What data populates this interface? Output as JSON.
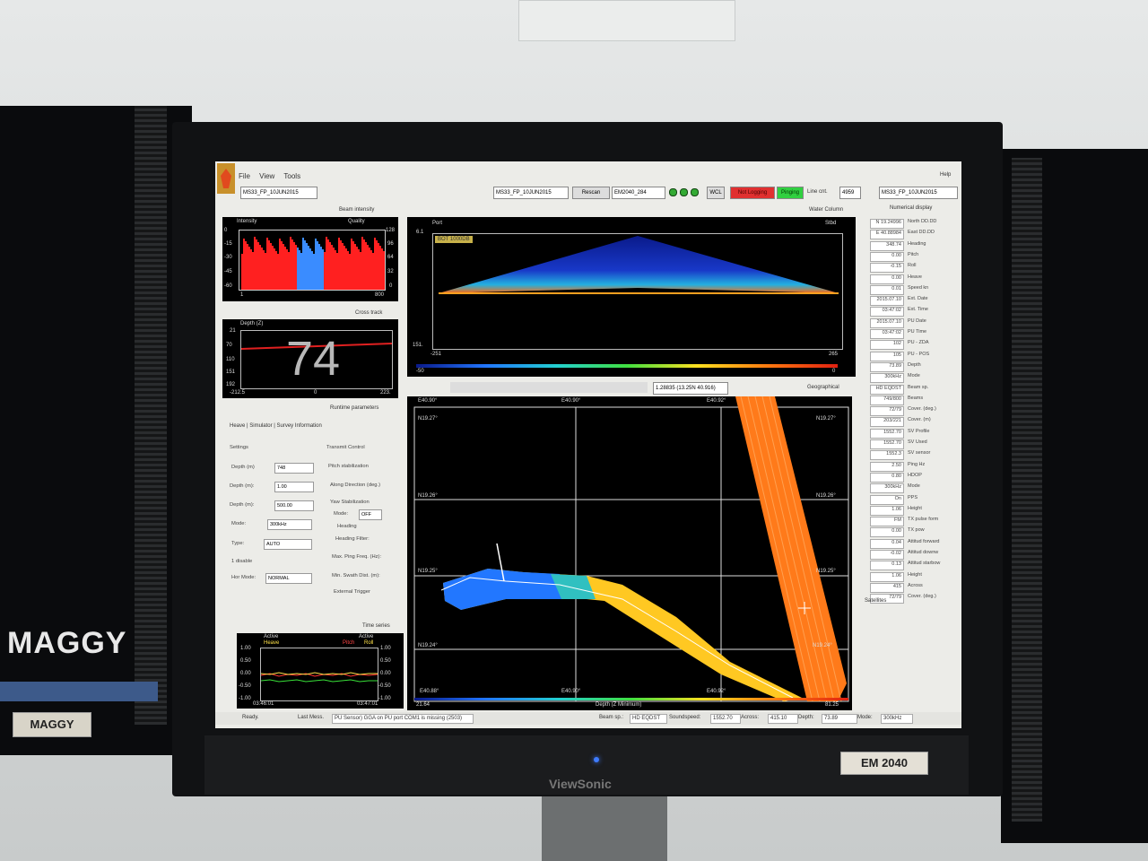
{
  "room": {
    "left_monitor_name": "MAGGY",
    "left_monitor_tag": "MAGGY",
    "right_tag": "EM 2040",
    "brand": "ViewSonic"
  },
  "app": {
    "menu": [
      "File",
      "View",
      "Tools"
    ],
    "help": "Help",
    "survey_select": "MS33_FP_10JUN2015",
    "survey_select2": "MS33_FP_10JUN2015",
    "rescan": "Rescan",
    "sonar_select": "EM2040_284",
    "wcl": "WCL",
    "not_logging": "Not Logging",
    "pinging": "Pinging",
    "line_cnt_label": "Line cnt.",
    "line_cnt": "4959",
    "survey_select3": "MS33_FP_10JUN2015"
  },
  "beam_panel": {
    "mode": "Beam intensity",
    "intensity_label": "Intensity",
    "quality_label": "Quality",
    "y_ticks": [
      "0",
      "-15",
      "-30",
      "-45",
      "-60"
    ],
    "q_ticks": [
      "128",
      "96",
      "64",
      "32",
      "0"
    ],
    "x_min": "1",
    "x_max": "800"
  },
  "cross_track": {
    "mode": "Cross track",
    "title": "Depth (Z)",
    "depth_value": "74",
    "y_ticks": [
      "21",
      "70",
      "110",
      "151",
      "192"
    ],
    "x_left": "-212.5",
    "x_mid": "0",
    "x_right": "223."
  },
  "water_column": {
    "mode": "Water Column",
    "port": "Port",
    "stbd": "Stbd",
    "top_val": "6.1",
    "bottom_val": "151.",
    "x_left": "-251",
    "x_right": "265",
    "badge": "BOT 1000DB",
    "scale_left": "-50",
    "scale_right": "0"
  },
  "runtime": {
    "mode": "Runtime parameters",
    "tabs": [
      "Heave",
      "Simulator",
      "Survey Information"
    ],
    "settings_label": "Settings",
    "transmit_label": "Transmit Control",
    "rows": [
      {
        "label": "Depth (m)",
        "value": "748"
      },
      {
        "label": "Depth (m):",
        "value": "1.00"
      },
      {
        "label": "Depth (m):",
        "value": "500.00"
      }
    ],
    "mode_label": "Mode:",
    "mode_value": "300kHz",
    "type_label": "Type:",
    "type_value": "AUTO",
    "disable_label": "1 disable",
    "hor_mode_label": "Hor Mode:",
    "hor_mode_value": "NORMAL",
    "pitch_stab": "Pitch stabilization",
    "along_direction": "Along Direction (deg.)",
    "yaw_stab": "Yaw Stabilization",
    "yaw_mode_label": "Mode:",
    "yaw_mode_value": "OFF",
    "heading": "Heading",
    "heading_filter": "Heading Filter:",
    "max_ping": "Max. Ping Freq. (Hz):",
    "min_swath": "Min. Swath Dist. (m):",
    "ext_trigger": "External Trigger"
  },
  "time_series": {
    "mode": "Time series",
    "left_title": "Active",
    "left_series": "Heave",
    "right_title": "Active",
    "right_series1": "Pitch",
    "right_series2": "Roll",
    "ticks": [
      "1.00",
      "0.50",
      "0.00",
      "-0.50",
      "-1.00"
    ],
    "t_start": "03:46:01",
    "t_end": "03:47:01"
  },
  "geo": {
    "mode": "Geographical",
    "coord_readout": "1.28835 (13.25N 40.916)",
    "top_labels": [
      "E40.90°",
      "E40.90°",
      "E40.92°"
    ],
    "bottom_labels": [
      "E40.88°",
      "E40.90°",
      "E40.92°"
    ],
    "left_labels": [
      "N19.27°",
      "N19.26°",
      "N19.25°",
      "N19.24°"
    ],
    "right_labels": [
      "N19.27°",
      "N19.26°",
      "N19.25°",
      "N19.24°"
    ],
    "scale_caption": "Depth (Z Minimum)",
    "scale_left": "21.64",
    "scale_right": "81.25"
  },
  "numerical": {
    "mode": "Numerical display",
    "rows": [
      {
        "v": "N 19.24996",
        "l": "North DD.DD"
      },
      {
        "v": "E 40.88984",
        "l": "East DD.DD"
      },
      {
        "v": "348.74",
        "l": "Heading"
      },
      {
        "v": "0.00",
        "l": "Pitch"
      },
      {
        "v": "-0.15",
        "l": "Roll"
      },
      {
        "v": "0.00",
        "l": "Heave"
      },
      {
        "v": "0.01",
        "l": "Speed kn"
      },
      {
        "v": "2015.07.10",
        "l": "Ext. Date"
      },
      {
        "v": "03:47:02",
        "l": "Ext. Time"
      },
      {
        "v": "2015.07.10",
        "l": "PU Date"
      },
      {
        "v": "03:47:02",
        "l": "PU Time"
      },
      {
        "v": "102",
        "l": "PU - ZDA"
      },
      {
        "v": "105",
        "l": "PU - POS"
      },
      {
        "v": "73.89",
        "l": "Depth"
      },
      {
        "v": "300kHz",
        "l": "Mode"
      },
      {
        "v": "HD EQDST",
        "l": "Beam sp."
      },
      {
        "v": "749/800",
        "l": "Beams"
      },
      {
        "v": "72/79",
        "l": "Cover. (deg.)"
      },
      {
        "v": "203/221",
        "l": "Cover. (m)"
      },
      {
        "v": "1552.70",
        "l": "SV Profile"
      },
      {
        "v": "1552.70",
        "l": "SV Used"
      },
      {
        "v": "1552.3",
        "l": "SV sensor"
      },
      {
        "v": "2.50",
        "l": "Ping Hz"
      },
      {
        "v": "0.80",
        "l": "HDOP"
      },
      {
        "v": "300kHz",
        "l": "Mode"
      },
      {
        "v": "On",
        "l": "PPS"
      },
      {
        "v": "1.06",
        "l": "Height"
      },
      {
        "v": "FM",
        "l": "TX pulse form"
      },
      {
        "v": "0.00",
        "l": "TX pow"
      },
      {
        "v": "0.04",
        "l": "Attitud forward"
      },
      {
        "v": "-0.02",
        "l": "Attitud downw"
      },
      {
        "v": "0.13",
        "l": "Attitud starbow"
      },
      {
        "v": "1.06",
        "l": "Height"
      },
      {
        "v": "415",
        "l": "Across"
      },
      {
        "v": "72/79",
        "l": "Cover. (deg.)"
      }
    ],
    "satellites": "Satellites"
  },
  "status": {
    "ready": "Ready.",
    "last_msg_label": "Last Mess.",
    "last_msg": "PU Sensor) GGA on PU port COM1 is missing  (2503)",
    "beam_sp_label": "Beam sp.:",
    "beam_sp": "HD EQDST",
    "soundspeed_label": "Soundspeed:",
    "soundspeed": "1552.70",
    "across_label": "Across:",
    "across": "415.10",
    "depth_label": "Depth:",
    "depth": "73.89",
    "mode_label": "Mode:",
    "mode": "300kHz"
  },
  "colors": {
    "bezel": "#111214",
    "screen_bg": "#ecece8",
    "plot_bg": "#000000",
    "red_status": "#e03030",
    "green_status": "#30d040",
    "swath_orange": "#ff7a1a",
    "swath_yellow": "#ffcc22",
    "swath_blue": "#2277ff"
  }
}
